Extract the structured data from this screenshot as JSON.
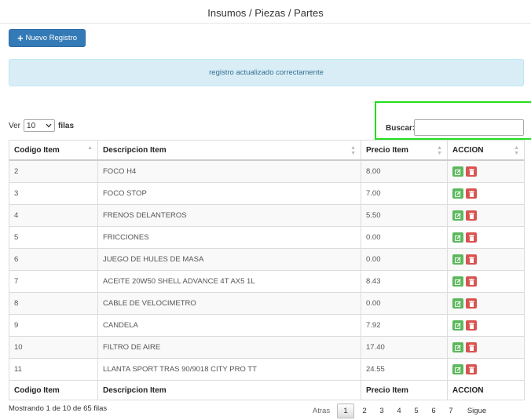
{
  "page": {
    "title": "Insumos / Piezas / Partes"
  },
  "toolbar": {
    "new_label": "Nuevo Registro",
    "new_icon": "plus-icon"
  },
  "alert": {
    "message": "registro actualizado correctamente"
  },
  "length": {
    "prefix": "Ver",
    "value": "10",
    "suffix": "filas"
  },
  "search": {
    "label": "Buscar:",
    "value": ""
  },
  "table": {
    "columns": [
      "Codigo Item",
      "Descripcion Item",
      "Precio Item",
      "ACCION"
    ],
    "rows": [
      {
        "code": "2",
        "desc": "FOCO H4",
        "price": "8.00"
      },
      {
        "code": "3",
        "desc": "FOCO STOP",
        "price": "7.00"
      },
      {
        "code": "4",
        "desc": "FRENOS DELANTEROS",
        "price": "5.50"
      },
      {
        "code": "5",
        "desc": "FRICCIONES",
        "price": "0.00"
      },
      {
        "code": "6",
        "desc": "JUEGO DE HULES DE MASA",
        "price": "0.00"
      },
      {
        "code": "7",
        "desc": "ACEITE 20W50 SHELL ADVANCE 4T AX5 1L",
        "price": "8.43"
      },
      {
        "code": "8",
        "desc": "CABLE DE VELOCIMETRO",
        "price": "0.00"
      },
      {
        "code": "9",
        "desc": "CANDELA",
        "price": "7.92"
      },
      {
        "code": "10",
        "desc": "FILTRO DE AIRE",
        "price": "17.40"
      },
      {
        "code": "11",
        "desc": "LLANTA SPORT TRAS 90/9018 CITY PRO TT",
        "price": "24.55"
      }
    ],
    "footer": [
      "Codigo Item",
      "Descripcion Item",
      "Precio Item",
      "ACCION"
    ]
  },
  "info": "Mostrando 1 de 10 de 65 filas",
  "pager": {
    "prev": "Atras",
    "pages": [
      "1",
      "2",
      "3",
      "4",
      "5",
      "6",
      "7"
    ],
    "current": "1",
    "next": "Sigue"
  },
  "colors": {
    "primary": "#337ab7",
    "success": "#5cb85c",
    "danger": "#d9534f",
    "alert_bg": "#d9edf7",
    "highlight": "#22e01c"
  }
}
